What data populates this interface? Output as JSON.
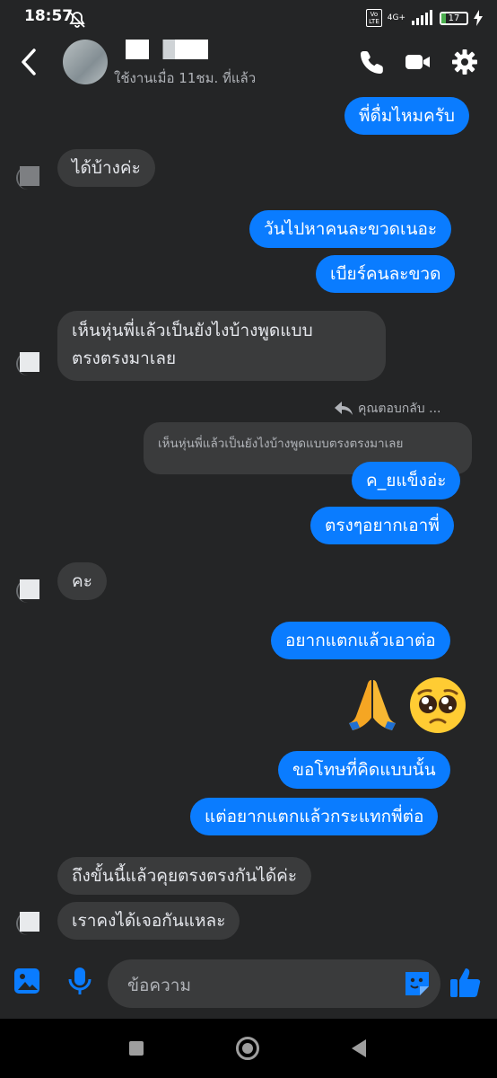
{
  "status_bar": {
    "time": "18:57",
    "network": "4G+",
    "volte": "Vo\nLTE",
    "battery": "17"
  },
  "header": {
    "last_seen": "ใช้งานเมื่อ 11ชม. ที่แล้ว",
    "icons": [
      "back-arrow-icon",
      "phone-icon",
      "video-icon",
      "gear-icon"
    ]
  },
  "messages": [
    {
      "from": "me",
      "text": "พี่ดื่มไหมครับ"
    },
    {
      "from": "them",
      "text": "ได้บ้างค่ะ"
    },
    {
      "from": "me",
      "text": "วันไปหาคนละขวดเนอะ"
    },
    {
      "from": "me",
      "text": "เบียร์คนละขวด"
    },
    {
      "from": "them",
      "text_line1": "เห็นหุ่นพี่แล้วเป็นยังไงบ้างพูดแบบ",
      "text_line2": "ตรงตรงมาเลย"
    },
    {
      "from": "me",
      "reply_label": "คุณตอบกลับ ...",
      "quoted": "เห็นหุ่นพี่แล้วเป็นยังไงบ้างพูดแบบตรงตรงมาเลย",
      "text": "ค_ยแข็งอ่ะ"
    },
    {
      "from": "me",
      "text": "ตรงๆอยากเอาพี่"
    },
    {
      "from": "them",
      "text": "คะ"
    },
    {
      "from": "me",
      "text": "อยากแตกแล้วเอาต่อ"
    },
    {
      "from": "me",
      "emoji": [
        "🙏",
        "🥺"
      ]
    },
    {
      "from": "me",
      "text": "ขอโทษที่คิดแบบนั้น"
    },
    {
      "from": "me",
      "text": "แต่อยากแตกแล้วกระแทกพี่ต่อ"
    },
    {
      "from": "them",
      "text": "ถึงขั้นนี้แล้วคุยตรงตรงกันได้ค่ะ"
    },
    {
      "from": "them",
      "text": "เราคงได้เจอกันแหละ"
    }
  ],
  "composer": {
    "placeholder": "ข้อความ"
  },
  "colors": {
    "background": "#242526",
    "my_bubble": "#0a7cff",
    "their_bubble": "#3a3b3c",
    "accent": "#0a7cff"
  }
}
